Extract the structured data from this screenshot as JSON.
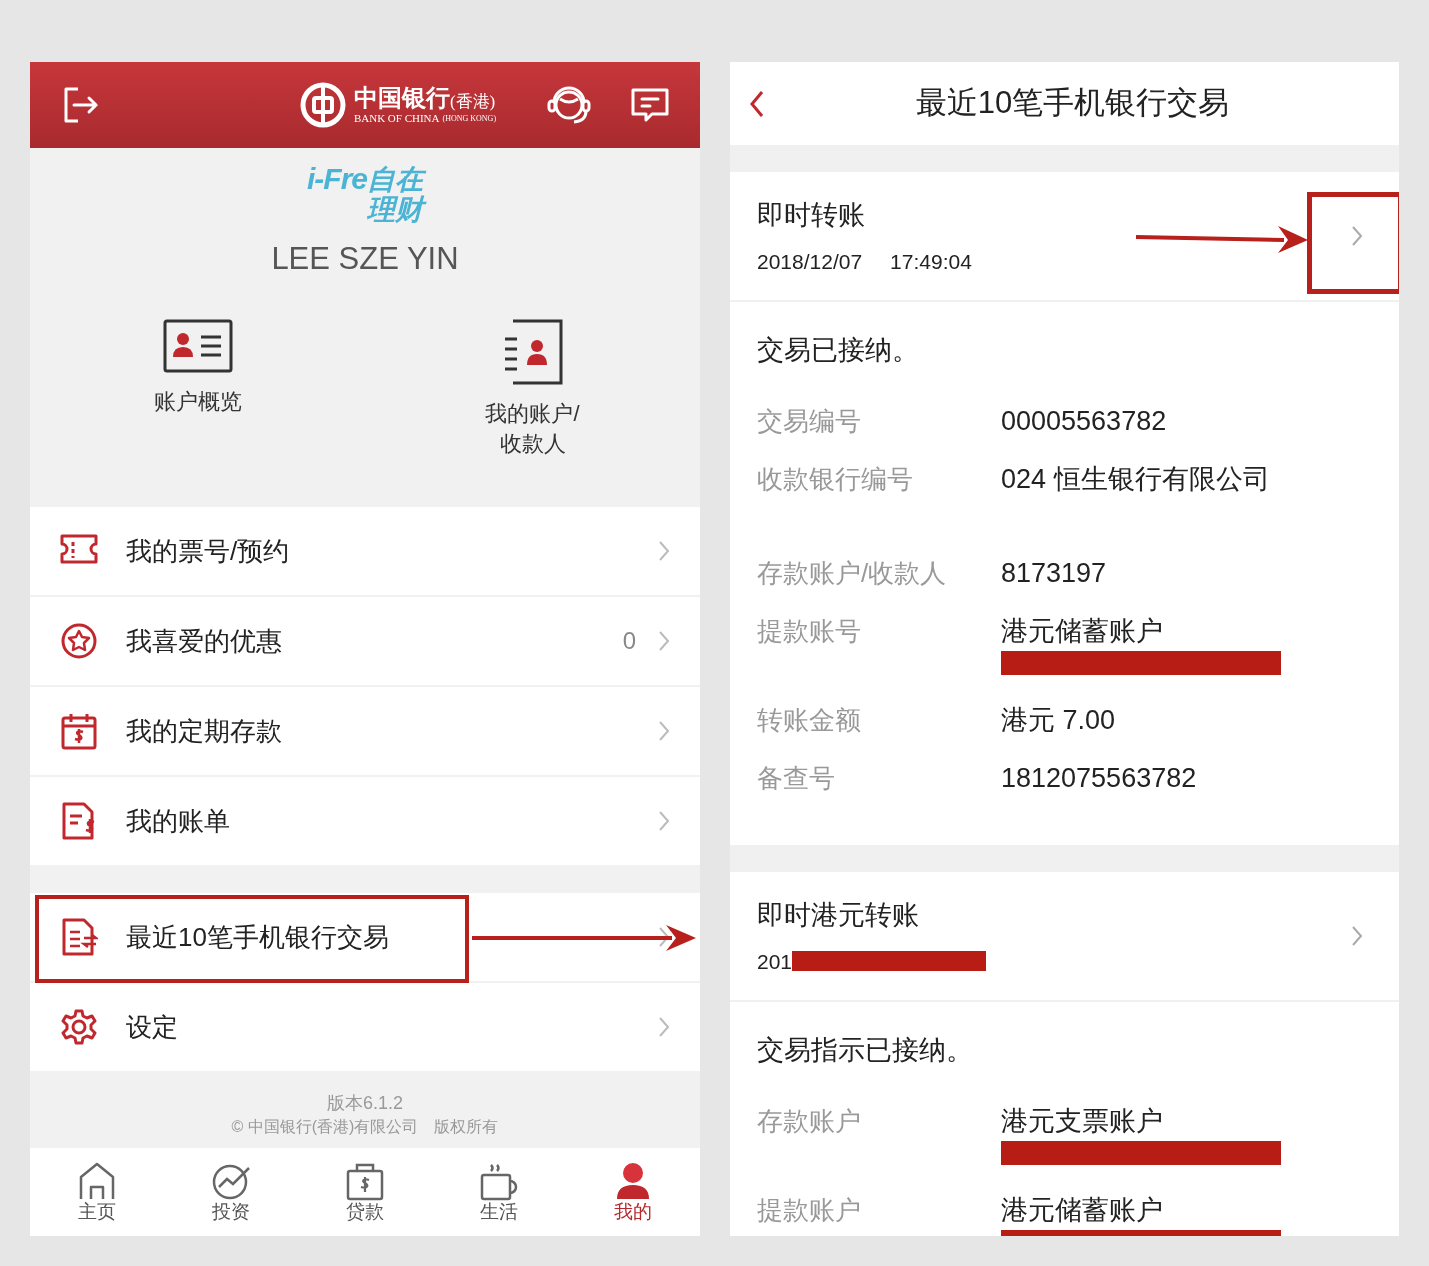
{
  "left": {
    "header": {
      "bank_name_cn": "中国银行",
      "bank_region_cn": "(香港)",
      "bank_name_en": "BANK OF CHINA",
      "bank_region_en": "(HONG KONG)"
    },
    "brand": {
      "latin": "i-Fre",
      "cn_top": "自在",
      "cn_bottom": "理财"
    },
    "user_name": "LEE SZE YIN",
    "shortcuts": [
      {
        "kind": "overview",
        "lines": [
          "账户概览"
        ]
      },
      {
        "kind": "accounts",
        "lines": [
          "我的账户/",
          "收款人"
        ]
      }
    ],
    "menu_groups": [
      [
        {
          "kind": "ticket",
          "label": "我的票号/预约",
          "highlighted": false
        },
        {
          "kind": "star",
          "label": "我喜爱的优惠",
          "count": "0",
          "highlighted": false
        },
        {
          "kind": "deposit",
          "label": "我的定期存款",
          "highlighted": false
        },
        {
          "kind": "bill",
          "label": "我的账单",
          "highlighted": false
        }
      ],
      [
        {
          "kind": "transactions",
          "label": "最近10笔手机银行交易",
          "highlighted": true
        },
        {
          "kind": "settings",
          "label": "设定",
          "highlighted": false
        }
      ]
    ],
    "version": "版本6.1.2",
    "copyright": "© 中国银行(香港)有限公司　版权所有",
    "nav": [
      {
        "kind": "home",
        "label": "主页",
        "selected": false
      },
      {
        "kind": "invest",
        "label": "投资",
        "selected": false
      },
      {
        "kind": "loan",
        "label": "贷款",
        "selected": false
      },
      {
        "kind": "life",
        "label": "生活",
        "selected": false
      },
      {
        "kind": "me",
        "label": "我的",
        "selected": true
      }
    ]
  },
  "right": {
    "title": "最近10笔手机银行交易",
    "transactions": [
      {
        "type": "即时转账",
        "date": "2018/12/07",
        "time": "17:49:04",
        "date_redacted": false,
        "highlighted": true,
        "status": "交易已接纳。",
        "fields": [
          {
            "label": "交易编号",
            "value": "00005563782",
            "redacted": false
          },
          {
            "label": "收款银行编号",
            "value": "024 恒生银行有限公司",
            "redacted": false
          },
          {
            "label": "存款账户/收款人",
            "value": "8173197",
            "redacted": false
          },
          {
            "label": "提款账号",
            "value": "港元储蓄账户",
            "redacted": true
          },
          {
            "label": "转账金额",
            "value": "港元 7.00",
            "redacted": false
          },
          {
            "label": "备查号",
            "value": "1812075563782",
            "redacted": false
          }
        ]
      },
      {
        "type": "即时港元转账",
        "date": "201",
        "date_redacted": true,
        "highlighted": false,
        "status": "交易指示已接纳。",
        "fields": [
          {
            "label": "存款账户",
            "value": "港元支票账户",
            "redacted": true
          },
          {
            "label": "提款账户",
            "value": "港元储蓄账户",
            "redacted": true
          }
        ]
      }
    ]
  }
}
